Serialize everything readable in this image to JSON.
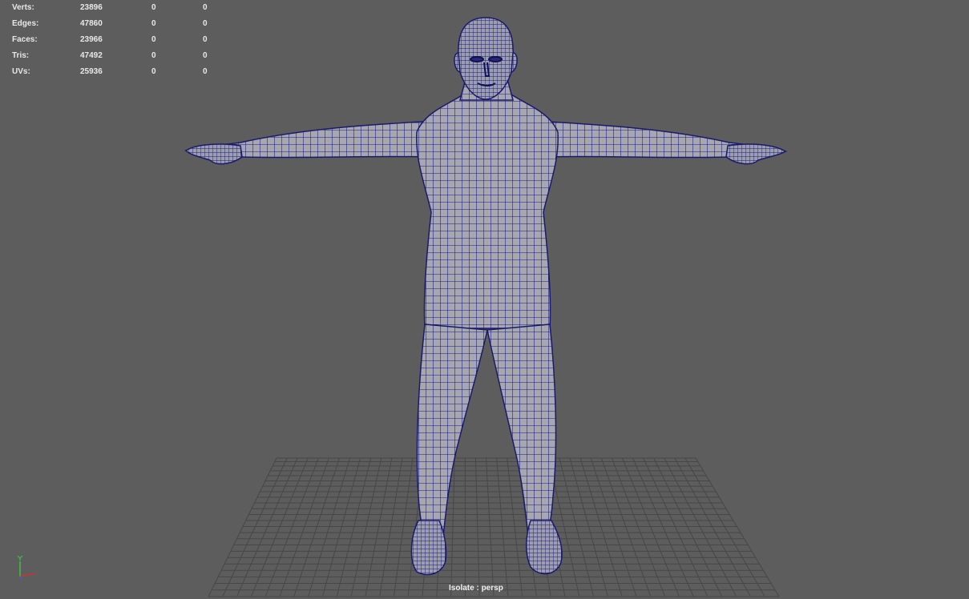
{
  "hud": {
    "rows": [
      {
        "label": "Verts:",
        "total": "23896",
        "selected": "0",
        "extra": "0"
      },
      {
        "label": "Edges:",
        "total": "47860",
        "selected": "0",
        "extra": "0"
      },
      {
        "label": "Faces:",
        "total": "23966",
        "selected": "0",
        "extra": "0"
      },
      {
        "label": "Tris:",
        "total": "47492",
        "selected": "0",
        "extra": "0"
      },
      {
        "label": "UVs:",
        "total": "25936",
        "selected": "0",
        "extra": "0"
      }
    ]
  },
  "status": {
    "isolate_label": "Isolate : persp"
  },
  "colors": {
    "viewport_bg": "#5d5d5d",
    "grid_line": "#474747",
    "mesh_fill": "#a7a7b3",
    "mesh_wire": "#1c1c78",
    "axis_y": "#40c040",
    "axis_x": "#d03030"
  },
  "icons": {
    "axis_gizmo": "xyz-axis-icon"
  }
}
